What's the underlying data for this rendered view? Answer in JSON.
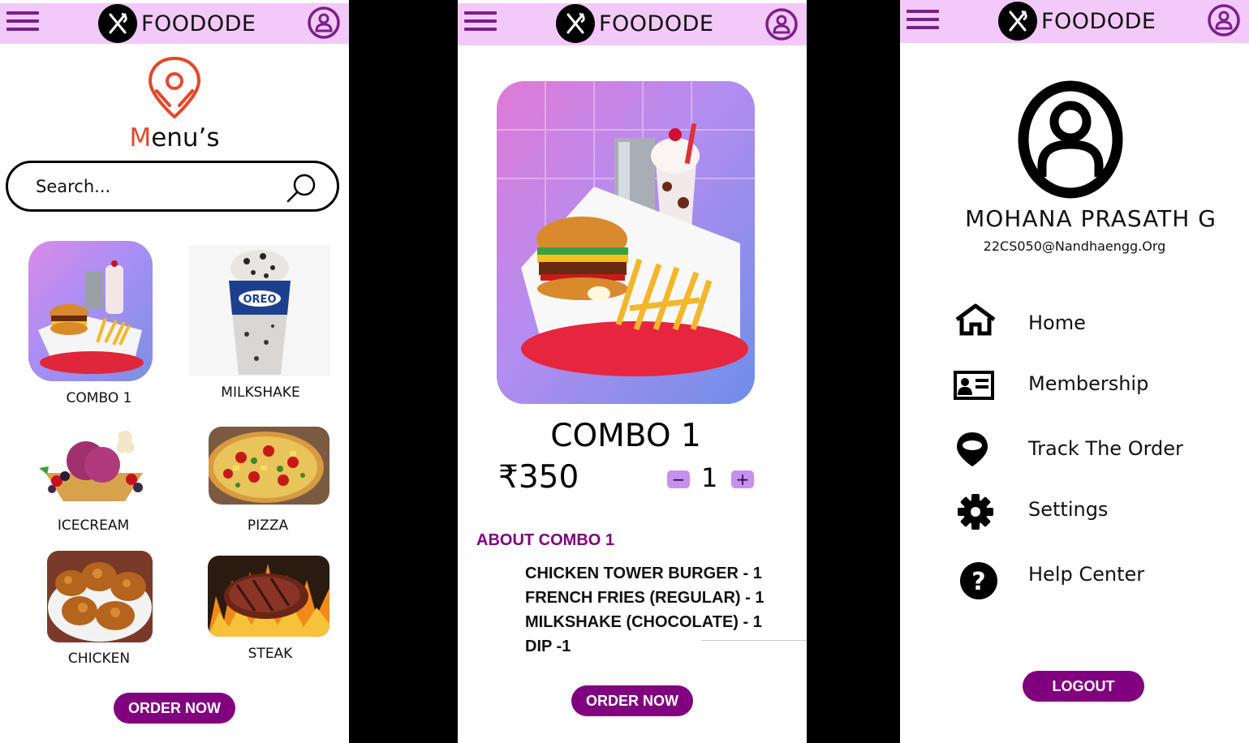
{
  "brand": {
    "name": "FOODODE",
    "accent": "#800080",
    "topbar_color": "#f3c9f9"
  },
  "screen1": {
    "menu_logo_text_first": "M",
    "menu_logo_text_rest": "enu’s",
    "search": {
      "placeholder": "Search..."
    },
    "categories": [
      {
        "label": "COMBO 1"
      },
      {
        "label": "MILKSHAKE"
      },
      {
        "label": "ICECREAM"
      },
      {
        "label": "PIZZA"
      },
      {
        "label": "CHICKEN"
      },
      {
        "label": "STEAK"
      }
    ],
    "order_button": "ORDER NOW"
  },
  "screen2": {
    "title": "COMBO 1",
    "price": "₹350",
    "quantity": "1",
    "minus": "−",
    "plus": "+",
    "about_heading": "ABOUT COMBO 1",
    "items": [
      "CHICKEN TOWER BURGER - 1",
      "FRENCH FRIES (REGULAR) - 1",
      "MILKSHAKE (CHOCOLATE) - 1",
      "DIP -1"
    ],
    "order_button": "ORDER NOW"
  },
  "screen3": {
    "user_name": "MOHANA PRASATH G",
    "email": "22CS050@Nandhaengg.Org",
    "nav": [
      {
        "label": "Home",
        "icon": "home-icon"
      },
      {
        "label": "Membership",
        "icon": "id-card-icon"
      },
      {
        "label": "Track The Order",
        "icon": "location-pin-icon"
      },
      {
        "label": "Settings",
        "icon": "gear-icon"
      },
      {
        "label": "Help Center",
        "icon": "question-icon"
      }
    ],
    "logout_button": "LOGOUT"
  }
}
